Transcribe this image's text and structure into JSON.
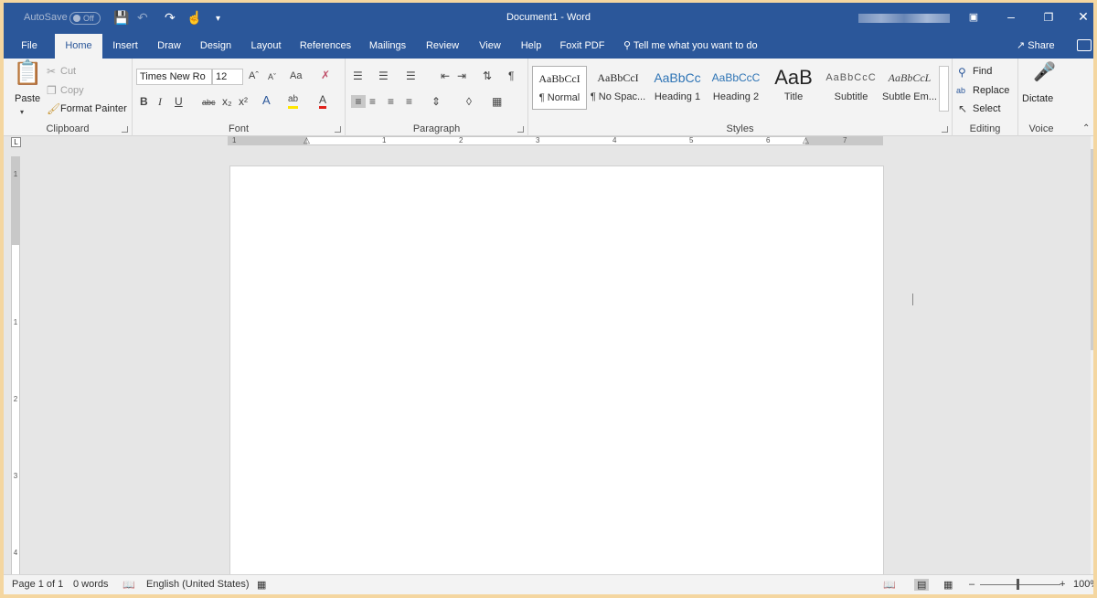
{
  "titlebar": {
    "autosave_label": "AutoSave",
    "autosave_state": "Off",
    "document_title": "Document1  -  Word"
  },
  "tabs": [
    "File",
    "Home",
    "Insert",
    "Draw",
    "Design",
    "Layout",
    "References",
    "Mailings",
    "Review",
    "View",
    "Help",
    "Foxit PDF"
  ],
  "tell_me": "Tell me what you want to do",
  "share_label": "Share",
  "clipboard": {
    "paste": "Paste",
    "cut": "Cut",
    "copy": "Copy",
    "format_painter": "Format Painter",
    "label": "Clipboard"
  },
  "font": {
    "name": "Times New Ro",
    "size": "12",
    "label": "Font",
    "case": "Aa"
  },
  "paragraph": {
    "label": "Paragraph"
  },
  "styles": {
    "label": "Styles",
    "items": [
      {
        "preview": "AaBbCcI",
        "name": "¶ Normal"
      },
      {
        "preview": "AaBbCcI",
        "name": "¶ No Spac..."
      },
      {
        "preview": "AaBbCc",
        "name": "Heading 1"
      },
      {
        "preview": "AaBbCcC",
        "name": "Heading 2"
      },
      {
        "preview": "AaB",
        "name": "Title"
      },
      {
        "preview": "AaBbCcC",
        "name": "Subtitle"
      },
      {
        "preview": "AaBbCcL",
        "name": "Subtle Em..."
      }
    ]
  },
  "editing": {
    "find": "Find",
    "replace": "Replace",
    "select": "Select",
    "label": "Editing"
  },
  "voice": {
    "dictate": "Dictate",
    "label": "Voice"
  },
  "ruler": {
    "h_numbers": [
      "1",
      "1",
      "2",
      "3",
      "4",
      "5",
      "6",
      "7"
    ],
    "v_numbers": [
      "1",
      "1",
      "2",
      "3",
      "4"
    ]
  },
  "status": {
    "page": "Page 1 of 1",
    "words": "0 words",
    "language": "English (United States)",
    "zoom": "100%"
  },
  "colors": {
    "brand": "#2b579a",
    "ribbon": "#f3f3f3",
    "page": "#ffffff"
  }
}
